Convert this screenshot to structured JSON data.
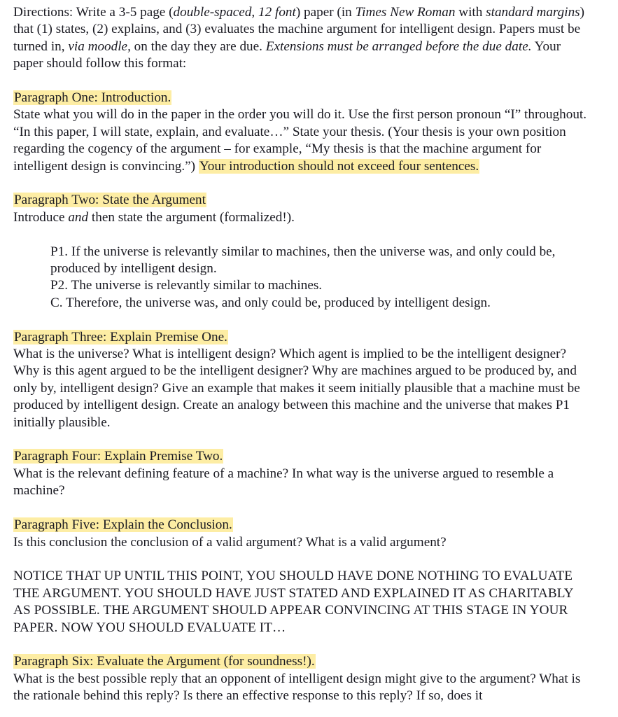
{
  "document": {
    "background_color": "#ffffff",
    "text_color": "#1a1a22",
    "highlight_color": "#fdeda4",
    "font_note": "Times New Roman serif body text",
    "sections": {
      "directions": {
        "seg1": "Directions: Write a 3-5 page (",
        "seg2_italic": "double-spaced, 12 font",
        "seg3": ") paper (in ",
        "seg4_italic": "Times New Roman",
        "seg5": " with ",
        "seg6_italic": "standard margins",
        "seg7": ") that (1) states, (2) explains, and (3) evaluates the machine argument for intelligent design. Papers must be turned in, ",
        "seg8_italic": "via moodle,",
        "seg9": " on the day they are due. ",
        "seg10_italic": "Extensions must be arranged before the due date.",
        "seg11": " Your paper should follow this format:"
      },
      "paragraph_one": {
        "heading": "Paragraph One: Introduction.",
        "body_part1": "State what you will do in the paper in the order you will do it. Use the first person pronoun “I” throughout. “In this paper, I will state, explain, and evaluate…” State your thesis. (Your thesis is your own position regarding the cogency of the argument – for example, “My thesis is that the machine argument for intelligent design is convincing.”) ",
        "body_highlight": "Your introduction should not exceed four sentences."
      },
      "paragraph_two": {
        "heading": "Paragraph Two: State the Argument",
        "body_seg1": "Introduce ",
        "body_seg2_italic": "and",
        "body_seg3": " then state the argument (formalized!).",
        "premises": [
          "P1. If the universe is relevantly similar to machines, then the universe was, and only could be, produced by intelligent design.",
          "P2. The universe is relevantly similar to machines.",
          "C. Therefore, the universe was, and only could be, produced by intelligent design."
        ]
      },
      "paragraph_three": {
        "heading": "Paragraph Three: Explain Premise One.",
        "body": "What is the universe? What is intelligent design? Which agent is implied to be the intelligent designer? Why is this agent argued to be the intelligent designer? Why are machines argued to be produced by, and only by, intelligent design? Give an example that makes it seem initially plausible that a machine must be produced by intelligent design. Create an analogy between this machine and the universe that makes P1 initially plausible."
      },
      "paragraph_four": {
        "heading": "Paragraph Four: Explain Premise Two.",
        "body": "What is the relevant defining feature of a machine? In what way is the universe argued to resemble a machine?"
      },
      "paragraph_five": {
        "heading": "Paragraph Five: Explain the Conclusion.",
        "body": "Is this conclusion the conclusion of a valid argument? What is a valid argument?"
      },
      "notice_block": {
        "text": "NOTICE THAT UP UNTIL THIS POINT, YOU SHOULD HAVE DONE NOTHING TO EVALUATE THE ARGUMENT. YOU SHOULD HAVE JUST STATED AND EXPLAINED IT AS CHARITABLY AS POSSIBLE. THE ARGUMENT SHOULD APPEAR CONVINCING AT THIS STAGE IN YOUR PAPER. NOW YOU SHOULD EVALUATE IT…"
      },
      "paragraph_six": {
        "heading": "Paragraph Six: Evaluate the Argument (for soundness!).",
        "body": "What is the best possible reply that an opponent of intelligent design might give to the argument? What is the rationale behind this reply? Is there an effective response to this reply? If so, does it"
      }
    }
  }
}
